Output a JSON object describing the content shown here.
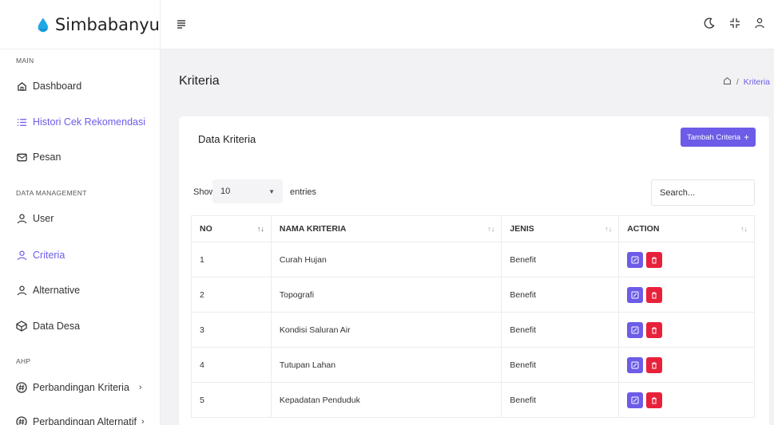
{
  "app": {
    "logo_text": "Simbabanyu"
  },
  "sidebar": {
    "sections": [
      {
        "label": "MAIN"
      },
      {
        "label": "DATA MANAGEMENT"
      },
      {
        "label": "AHP"
      }
    ],
    "items": [
      {
        "label": "Dashboard",
        "icon": "home-icon"
      },
      {
        "label": "Histori Cek Rekomendasi",
        "icon": "list-icon"
      },
      {
        "label": "Pesan",
        "icon": "mail-icon"
      },
      {
        "label": "User",
        "icon": "user-icon"
      },
      {
        "label": "Criteria",
        "icon": "user-icon"
      },
      {
        "label": "Alternative",
        "icon": "user-icon"
      },
      {
        "label": "Data Desa",
        "icon": "box-icon"
      },
      {
        "label": "Perbandingan Kriteria",
        "icon": "hash-icon"
      },
      {
        "label": "Perbandingan Alternatif",
        "icon": "hash-icon"
      }
    ]
  },
  "header": {
    "page_title": "Kriteria"
  },
  "breadcrumb": {
    "separator": "/",
    "current": "Kriteria"
  },
  "card": {
    "title": "Data Kriteria",
    "add_button_label": "Tambah Criteria",
    "add_button_icon": "+",
    "show_label": "Show",
    "entries_value": "10",
    "entries_label": "entries",
    "search_placeholder": "Search..."
  },
  "table": {
    "columns": [
      "NO",
      "NAMA KRITERIA",
      "JENIS",
      "ACTION"
    ],
    "rows": [
      {
        "no": "1",
        "nama": "Curah Hujan",
        "jenis": "Benefit"
      },
      {
        "no": "2",
        "nama": "Topografi",
        "jenis": "Benefit"
      },
      {
        "no": "3",
        "nama": "Kondisi Saluran Air",
        "jenis": "Benefit"
      },
      {
        "no": "4",
        "nama": "Tutupan Lahan",
        "jenis": "Benefit"
      },
      {
        "no": "5",
        "nama": "Kepadatan Penduduk",
        "jenis": "Benefit"
      }
    ]
  },
  "colors": {
    "accent": "#6c5ce7",
    "danger": "#e8213b",
    "background": "#f2f2f5"
  }
}
